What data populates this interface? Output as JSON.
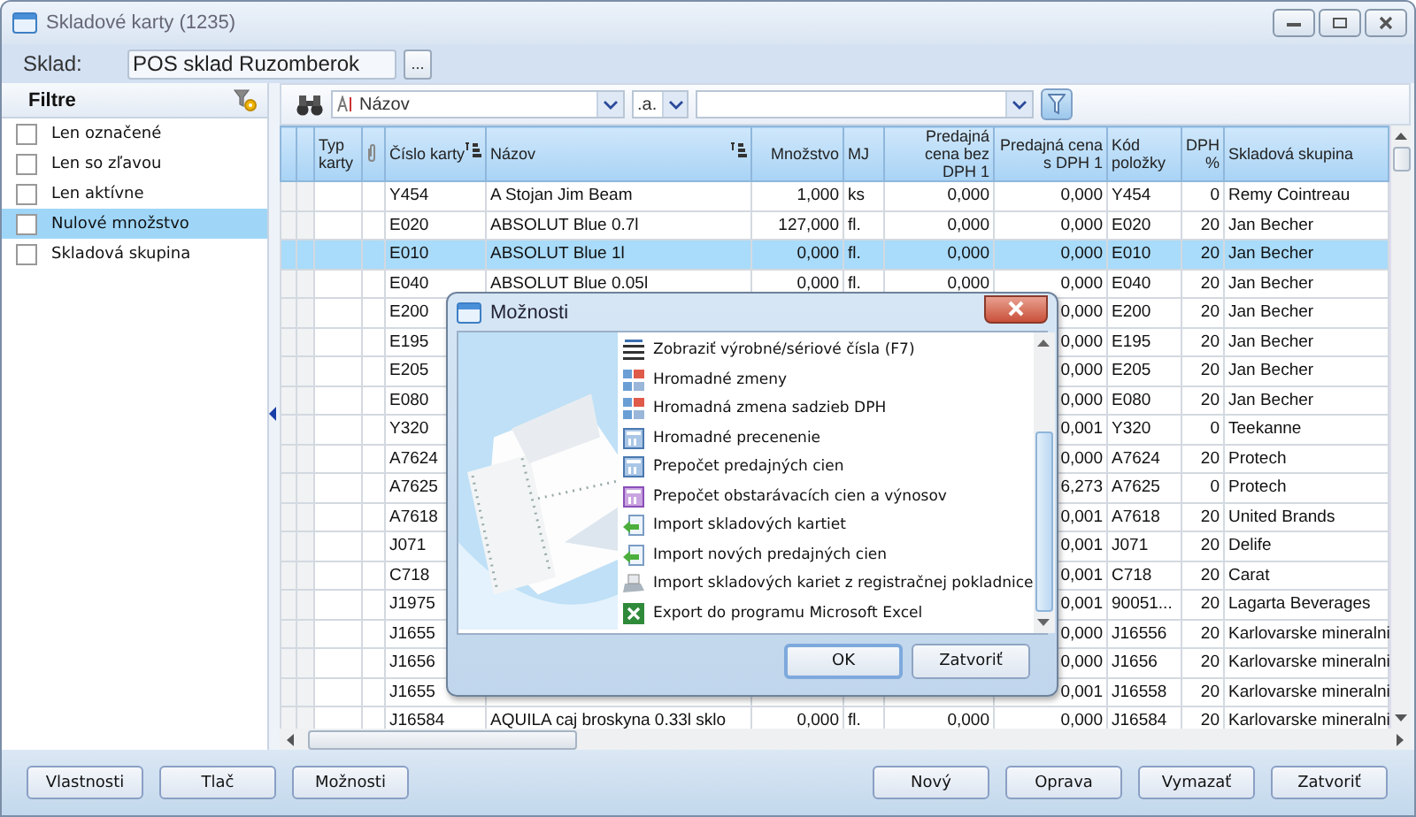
{
  "window": {
    "title": "Skladové karty (1235)"
  },
  "sklad": {
    "label": "Sklad:",
    "value": "POS sklad Ruzomberok",
    "browse_button": "..."
  },
  "filter_panel": {
    "title": "Filtre",
    "items": [
      {
        "label": "Len označené",
        "checked": false,
        "selected": false
      },
      {
        "label": "Len so zľavou",
        "checked": false,
        "selected": false
      },
      {
        "label": "Len aktívne",
        "checked": false,
        "selected": false
      },
      {
        "label": "Nulové množstvo",
        "checked": false,
        "selected": true
      },
      {
        "label": "Skladová skupina",
        "checked": false,
        "selected": false
      }
    ]
  },
  "toolbar": {
    "column_select": "Názov",
    "mode_select": ".a."
  },
  "table": {
    "columns": {
      "typ_karty": "Typ karty",
      "cislo_karty": "Číslo karty",
      "nazov": "Názov",
      "mnozstvo": "Množstvo",
      "mj": "MJ",
      "cena_bez_dph": "Predajná cena bez DPH 1",
      "cena_s_dph": "Predajná cena s DPH 1",
      "kod_polozky": "Kód položky",
      "dph": "DPH %",
      "skladova_skupina": "Skladová skupina"
    },
    "rows": [
      {
        "selected": false,
        "cislo_karty": "Y454",
        "nazov": "A Stojan  Jim Beam",
        "mnozstvo": "1,000",
        "mj": "ks",
        "cena_bez_dph": "0,000",
        "cena_s_dph": "0,000",
        "kod_polozky": "Y454",
        "dph": "0",
        "skladova_skupina": "Remy Cointreau"
      },
      {
        "selected": false,
        "cislo_karty": "E020",
        "nazov": "ABSOLUT Blue   0.7l",
        "mnozstvo": "127,000",
        "mj": "fl.",
        "cena_bez_dph": "0,000",
        "cena_s_dph": "0,000",
        "kod_polozky": "E020",
        "dph": "20",
        "skladova_skupina": "Jan Becher"
      },
      {
        "selected": true,
        "cislo_karty": "E010",
        "nazov": "ABSOLUT Blue   1l",
        "mnozstvo": "0,000",
        "mj": "fl.",
        "cena_bez_dph": "0,000",
        "cena_s_dph": "0,000",
        "kod_polozky": "E010",
        "dph": "20",
        "skladova_skupina": "Jan Becher"
      },
      {
        "selected": false,
        "cislo_karty": "E040",
        "nazov": "ABSOLUT Blue   0.05l",
        "mnozstvo": "0,000",
        "mj": "fl.",
        "cena_bez_dph": "0,000",
        "cena_s_dph": "0,000",
        "kod_polozky": "E040",
        "dph": "20",
        "skladova_skupina": "Jan Becher"
      },
      {
        "selected": false,
        "cislo_karty": "E200",
        "cena_s_dph": "0,000",
        "kod_polozky": "E200",
        "dph": "20",
        "skladova_skupina": "Jan Becher"
      },
      {
        "selected": false,
        "cislo_karty": "E195",
        "cena_s_dph": "0,000",
        "kod_polozky": "E195",
        "dph": "20",
        "skladova_skupina": "Jan Becher"
      },
      {
        "selected": false,
        "cislo_karty": "E205",
        "cena_s_dph": "0,000",
        "kod_polozky": "E205",
        "dph": "20",
        "skladova_skupina": "Jan Becher"
      },
      {
        "selected": false,
        "cislo_karty": "E080",
        "cena_s_dph": "0,000",
        "kod_polozky": "E080",
        "dph": "20",
        "skladova_skupina": "Jan Becher"
      },
      {
        "selected": false,
        "cislo_karty": "Y320",
        "cena_s_dph": "0,001",
        "kod_polozky": "Y320",
        "dph": "0",
        "skladova_skupina": "Teekanne"
      },
      {
        "selected": false,
        "cislo_karty": "A7624",
        "cena_s_dph": "0,000",
        "kod_polozky": "A7624",
        "dph": "20",
        "skladova_skupina": "Protech"
      },
      {
        "selected": false,
        "cislo_karty": "A7625",
        "cena_s_dph": "6,273",
        "kod_polozky": "A7625",
        "dph": "0",
        "skladova_skupina": "Protech"
      },
      {
        "selected": false,
        "cislo_karty": "A7618",
        "cena_s_dph": "0,001",
        "kod_polozky": "A7618",
        "dph": "20",
        "skladova_skupina": "United Brands"
      },
      {
        "selected": false,
        "cislo_karty": "J071",
        "cena_s_dph": "0,001",
        "kod_polozky": "J071",
        "dph": "20",
        "skladova_skupina": "Delife"
      },
      {
        "selected": false,
        "cislo_karty": "C718",
        "cena_s_dph": "0,001",
        "kod_polozky": "C718",
        "dph": "20",
        "skladova_skupina": "Carat"
      },
      {
        "selected": false,
        "cislo_karty": "J1975",
        "cena_s_dph": "0,001",
        "kod_polozky": "90051...",
        "dph": "20",
        "skladova_skupina": "Lagarta Beverages"
      },
      {
        "selected": false,
        "cislo_karty": "J1655",
        "cena_s_dph": "0,000",
        "kod_polozky": "J16556",
        "dph": "20",
        "skladova_skupina": "Karlovarske mineralni"
      },
      {
        "selected": false,
        "cislo_karty": "J1656",
        "cena_s_dph": "0,000",
        "kod_polozky": "J1656",
        "dph": "20",
        "skladova_skupina": "Karlovarske mineralni"
      },
      {
        "selected": false,
        "cislo_karty": "J1655",
        "cena_s_dph": "0,001",
        "kod_polozky": "J16558",
        "dph": "20",
        "skladova_skupina": "Karlovarske mineralni"
      },
      {
        "selected": false,
        "cislo_karty": "J16584",
        "nazov": "AQUILA caj broskyna 0.33l sklo",
        "mnozstvo": "0,000",
        "mj": "fl.",
        "cena_bez_dph": "0,000",
        "cena_s_dph": "0,000",
        "kod_polozky": "J16584",
        "dph": "20",
        "skladova_skupina": "Karlovarske mineralni"
      }
    ]
  },
  "dialog": {
    "title": "Možnosti",
    "items": [
      "Zobraziť výrobné/sériové čísla (F7)",
      "Hromadné zmeny",
      "Hromadná zmena sadzieb DPH",
      "Hromadné precenenie",
      "Prepočet predajných cien",
      "Prepočet obstarávacích cien a výnosov",
      "Import skladových kartiet",
      "Import nových predajných cien",
      "Import skladových kariet z registračnej pokladnice",
      "Export do programu Microsoft Excel"
    ],
    "buttons": [
      "OK",
      "Zatvoriť"
    ]
  },
  "bottom_bar": {
    "left_buttons": [
      "Vlastnosti",
      "Tlač",
      "Možnosti"
    ],
    "right_buttons": [
      "Nový",
      "Oprava",
      "Vymazať",
      "Zatvoriť"
    ]
  }
}
